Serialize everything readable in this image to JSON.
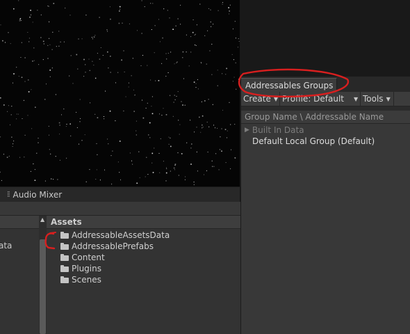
{
  "audio_mixer": {
    "tab_label": "Audio Mixer",
    "icon": "mixer-sliders-icon"
  },
  "project": {
    "tree_item_fragment": "ata",
    "assets_header": "Assets",
    "folders": [
      "AddressableAssetsData",
      "AddressablePrefabs",
      "Content",
      "Plugins",
      "Scenes"
    ]
  },
  "addressables": {
    "tab_label": "Addressables Groups",
    "toolbar": {
      "create": "Create",
      "profile": "Profile: Default",
      "tools": "Tools"
    },
    "column_header": "Group Name \\ Addressable Name",
    "groups": [
      {
        "label": "Built In Data",
        "disabled": true
      },
      {
        "label": "Default Local Group (Default)",
        "disabled": false
      }
    ]
  },
  "colors": {
    "annotation": "#d81f1f",
    "panel": "#383838",
    "scene": "#050505"
  }
}
